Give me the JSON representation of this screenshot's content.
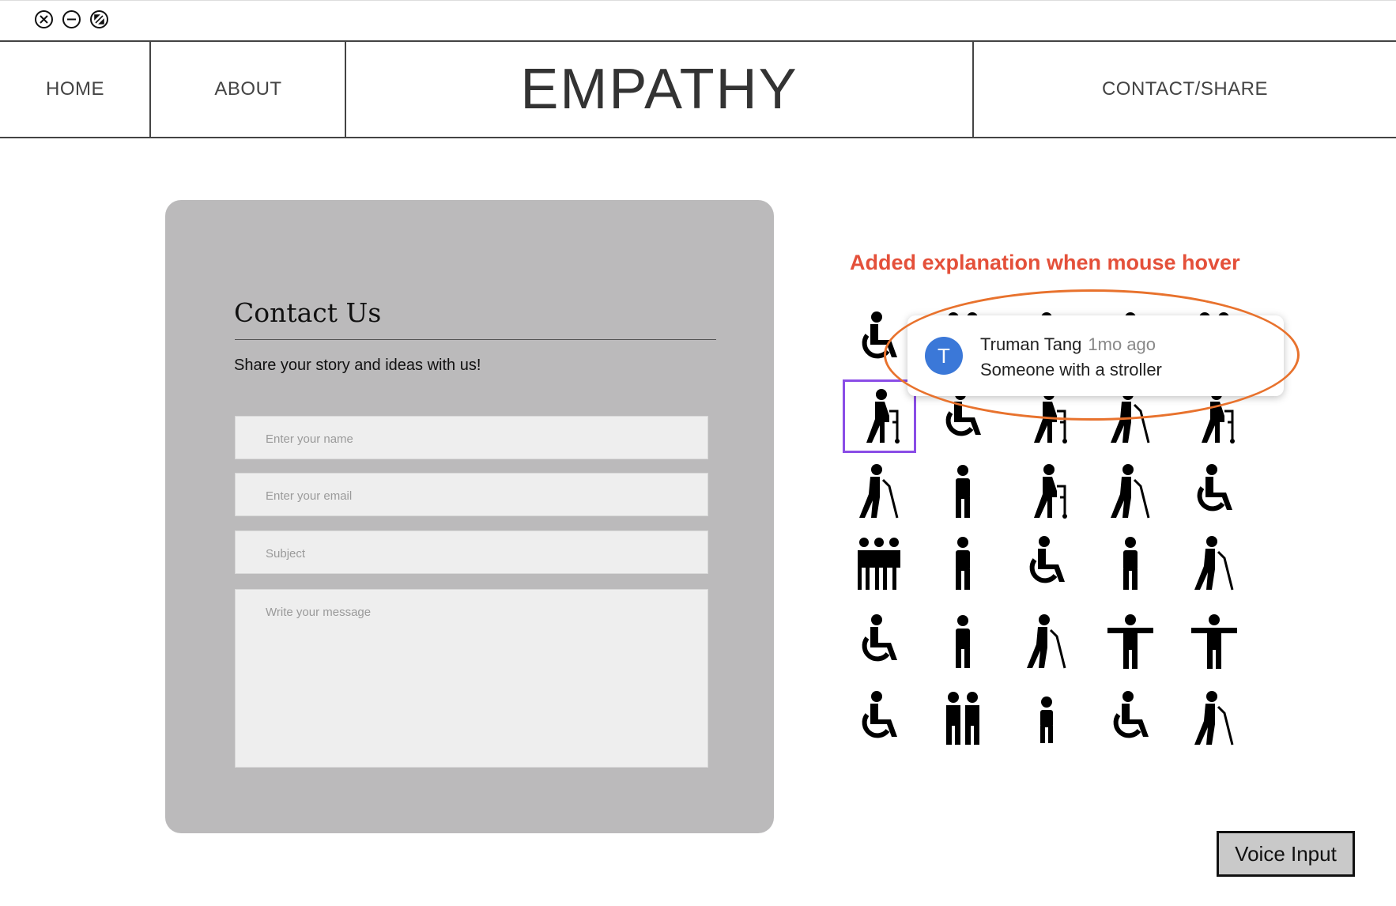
{
  "nav": {
    "home": "HOME",
    "about": "ABOUT",
    "brand": "EMPATHY",
    "contact": "CONTACT/SHARE"
  },
  "contact_card": {
    "title": "Contact Us",
    "subtitle": "Share your story and ideas with us!",
    "name_placeholder": "Enter your name",
    "email_placeholder": "Enter your email",
    "subject_placeholder": "Subject",
    "message_placeholder": "Write your message"
  },
  "annotation": {
    "text": "Added explanation when mouse hover",
    "color": "#e4503a",
    "ellipse_color": "#e8722d"
  },
  "tooltip": {
    "avatar_letter": "T",
    "author": "Truman Tang",
    "age": "1mo ago",
    "message": "Someone with a stroller"
  },
  "icons": {
    "selected_icon": "walker-person-icon",
    "selection_color": "#8a4de6",
    "grid": [
      [
        "active-wheelchair-icon",
        "two-people-icon",
        "person-icon",
        "person-icon",
        "two-people-icon"
      ],
      [
        "walker-person-icon",
        "powerchair-icon",
        "person-with-stroller-icon",
        "person-walking-icon",
        "person-with-walker-icon"
      ],
      [
        "elderly-cane-icon",
        "person-icon",
        "group-with-walker-icon",
        "blind-person-cane-icon",
        "wheelchair-icon"
      ],
      [
        "group-icon",
        "person-icon",
        "wheelchair-icon",
        "person-icon",
        "person-walking-icon"
      ],
      [
        "wheelchair-icon",
        "person-icon",
        "blind-person-cane-icon",
        "person-arms-out-icon",
        "person-arm-out-icon"
      ],
      [
        "active-wheelchair-icon",
        "two-people-icon",
        "child-icon",
        "wheelchair-icon",
        "group-with-cane-icon"
      ]
    ]
  },
  "voice_input": {
    "label": "Voice Input"
  }
}
